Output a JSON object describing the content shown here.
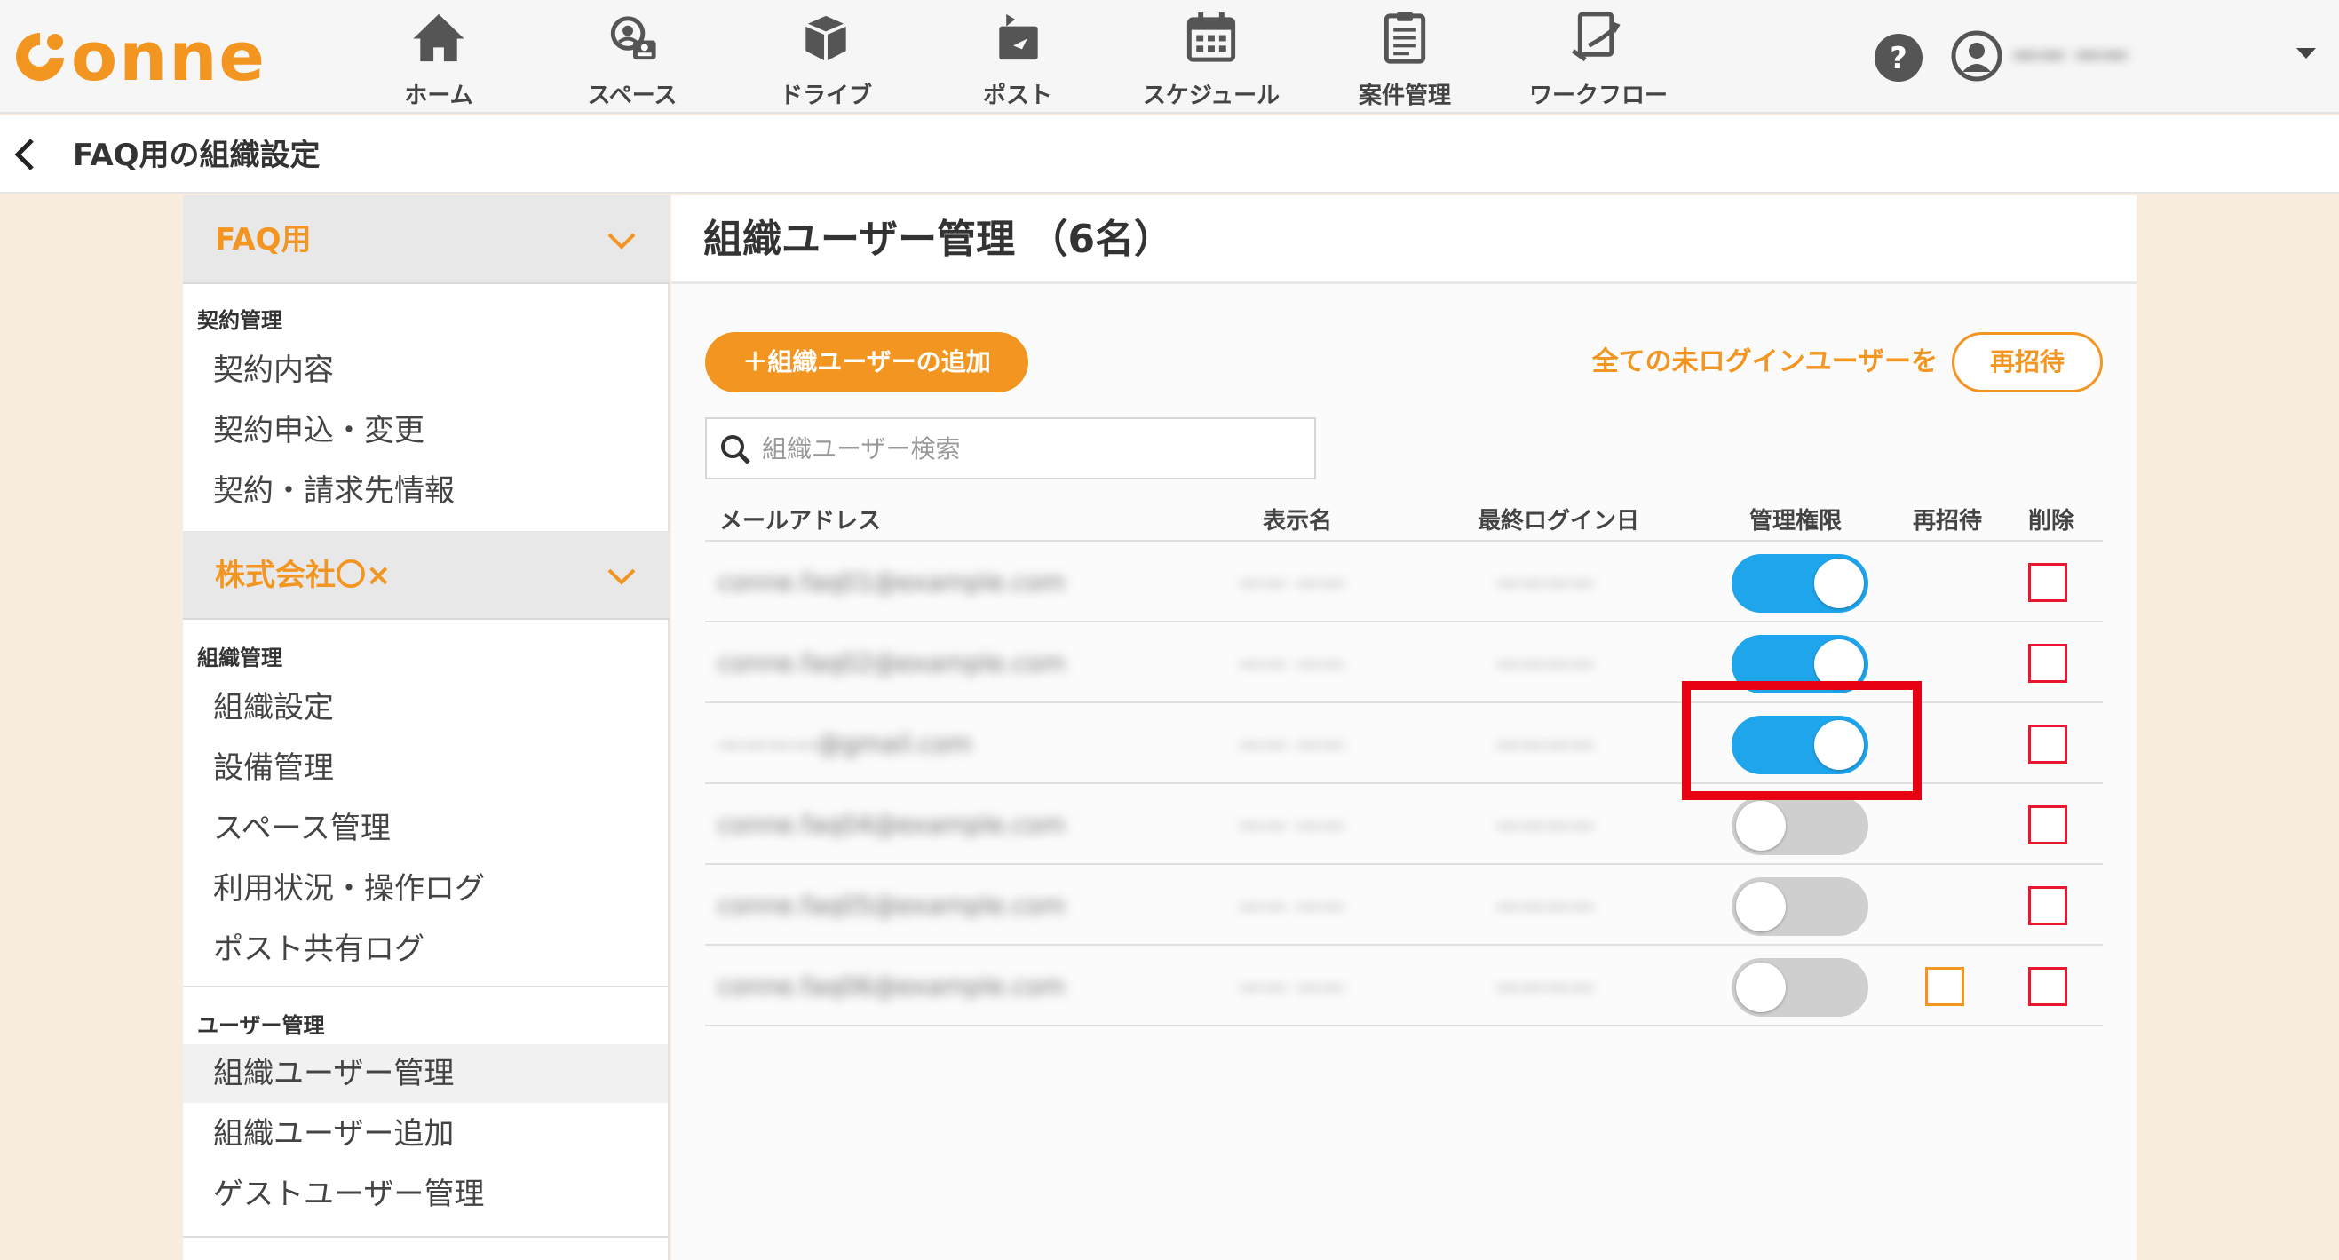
{
  "app": {
    "logo_text": "onne",
    "brand_color": "#f29621"
  },
  "nav": [
    {
      "label": "ホーム",
      "icon": "home-icon"
    },
    {
      "label": "スペース",
      "icon": "space-icon"
    },
    {
      "label": "ドライブ",
      "icon": "drive-icon"
    },
    {
      "label": "ポスト",
      "icon": "post-icon"
    },
    {
      "label": "スケジュール",
      "icon": "calendar-icon"
    },
    {
      "label": "案件管理",
      "icon": "clipboard-icon"
    },
    {
      "label": "ワークフロー",
      "icon": "workflow-icon"
    }
  ],
  "header": {
    "user_name": "—— ——"
  },
  "subheader": {
    "title": "FAQ用の組織設定"
  },
  "sidebar": {
    "group1": {
      "title": "FAQ用",
      "section": "契約管理",
      "items": [
        "契約内容",
        "契約申込・変更",
        "契約・請求先情報"
      ]
    },
    "group2": {
      "title": "株式会社〇×",
      "sections": [
        {
          "title": "組織管理",
          "items": [
            "組織設定",
            "設備管理",
            "スペース管理",
            "利用状況・操作ログ",
            "ポスト共有ログ"
          ]
        },
        {
          "title": "ユーザー管理",
          "items": [
            "組織ユーザー管理",
            "組織ユーザー追加",
            "ゲストユーザー管理"
          ]
        }
      ],
      "active_item": "組織ユーザー管理"
    }
  },
  "main": {
    "title": "組織ユーザー管理 （6名）",
    "add_button": "＋組織ユーザーの追加",
    "reinvite_text": "全ての未ログインユーザーを",
    "reinvite_button": "再招待",
    "search_placeholder": "組織ユーザー検索",
    "columns": [
      "メールアドレス",
      "表示名",
      "最終ログイン日",
      "管理権限",
      "再招待",
      "削除"
    ],
    "rows": [
      {
        "email": "conne.faq01@example.com",
        "name": "—— ——",
        "last_login": "————",
        "admin": true,
        "reinvite": false
      },
      {
        "email": "conne.faq02@example.com",
        "name": "—— ——",
        "last_login": "————",
        "admin": true,
        "reinvite": false
      },
      {
        "email": "————@gmail.com",
        "name": "—— ——",
        "last_login": "————",
        "admin": true,
        "reinvite": false
      },
      {
        "email": "conne.faq04@example.com",
        "name": "—— ——",
        "last_login": "————",
        "admin": false,
        "reinvite": false
      },
      {
        "email": "conne.faq05@example.com",
        "name": "—— ——",
        "last_login": "————",
        "admin": false,
        "reinvite": false
      },
      {
        "email": "conne.faq06@example.com",
        "name": "—— ——",
        "last_login": "————",
        "admin": false,
        "reinvite": true
      }
    ]
  },
  "colors": {
    "toggle_on": "#1fa5ec",
    "toggle_off": "#cfcfcf",
    "delete_checkbox": "#e8162e",
    "reinvite_checkbox": "#f29621",
    "highlight": "#e60012"
  }
}
